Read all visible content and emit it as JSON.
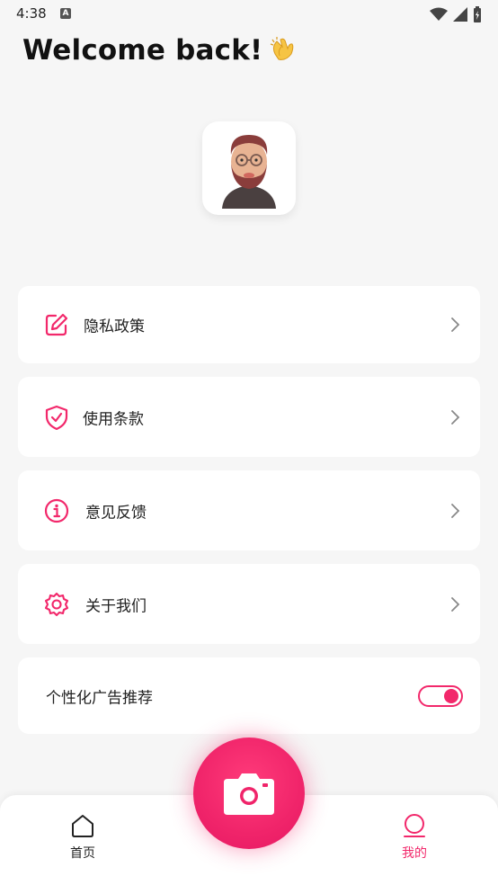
{
  "status_bar": {
    "time": "4:38",
    "indicator": "A"
  },
  "header": {
    "title": "Welcome back!"
  },
  "menu": {
    "items": [
      {
        "label": "隐私政策",
        "icon": "edit-icon"
      },
      {
        "label": "使用条款",
        "icon": "shield-check-icon"
      },
      {
        "label": "意见反馈",
        "icon": "info-icon"
      },
      {
        "label": "关于我们",
        "icon": "settings-icon"
      }
    ],
    "toggle_item": {
      "label": "个性化广告推荐",
      "enabled": true
    }
  },
  "bottom_nav": {
    "home_label": "首页",
    "mine_label": "我的",
    "active": "mine"
  },
  "colors": {
    "accent": "#f2286b",
    "background": "#f6f6f6",
    "card": "#ffffff"
  }
}
